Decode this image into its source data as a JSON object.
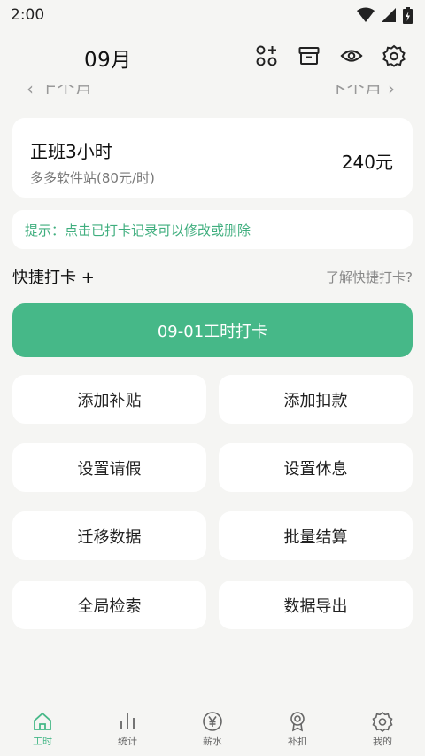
{
  "status": {
    "time": "2:00"
  },
  "header": {
    "month": "09月"
  },
  "peek": {
    "prev": "‹ 上个月",
    "next": "下个月 ›"
  },
  "record": {
    "title": "正班3小时",
    "subtitle": "多多软件站(80元/时)",
    "amount": "240元"
  },
  "tip": {
    "text": "提示：点击已打卡记录可以修改或删除"
  },
  "quick": {
    "title": "快捷打卡 +",
    "help": "了解快捷打卡?"
  },
  "punch": {
    "label": "09-01工时打卡"
  },
  "actions": [
    {
      "label": "添加补贴"
    },
    {
      "label": "添加扣款"
    },
    {
      "label": "设置请假"
    },
    {
      "label": "设置休息"
    },
    {
      "label": "迁移数据"
    },
    {
      "label": "批量结算"
    },
    {
      "label": "全局检索"
    },
    {
      "label": "数据导出"
    }
  ],
  "nav": [
    {
      "label": "工时",
      "icon": "home-icon"
    },
    {
      "label": "统计",
      "icon": "bar-chart-icon"
    },
    {
      "label": "薪水",
      "icon": "yen-coin-icon"
    },
    {
      "label": "补扣",
      "icon": "award-icon"
    },
    {
      "label": "我的",
      "icon": "gear-icon"
    }
  ],
  "colors": {
    "accent": "#46b888",
    "tip": "#3fae7e",
    "background": "#f5f5f3"
  }
}
